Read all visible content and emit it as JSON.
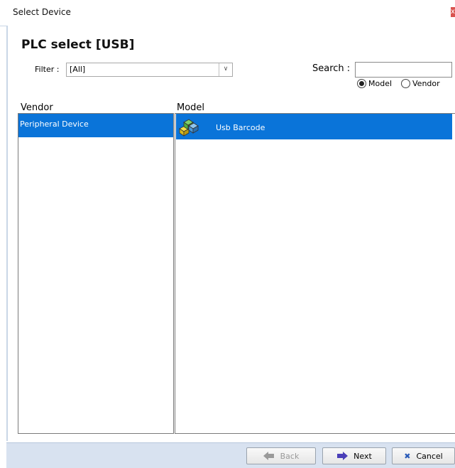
{
  "window": {
    "title": "Select Device",
    "close_label": "x"
  },
  "heading": "PLC select [USB]",
  "filter": {
    "label": "Filter :",
    "value": "[All]"
  },
  "search": {
    "label": "Search :",
    "value": ""
  },
  "search_mode": {
    "options": [
      "Model",
      "Vendor"
    ],
    "selected": "Model"
  },
  "columns": {
    "vendor": "Vendor",
    "model": "Model"
  },
  "vendors": [
    {
      "name": "Peripheral Device",
      "selected": true
    }
  ],
  "models": [
    {
      "name": "Usb Barcode",
      "icon": "usb-barcode-cubes-icon",
      "selected": true
    }
  ],
  "buttons": {
    "back": "Back",
    "next": "Next",
    "cancel": "Cancel"
  },
  "colors": {
    "selection": "#0a74d9",
    "bottom_bar": "#d8e2f0"
  }
}
